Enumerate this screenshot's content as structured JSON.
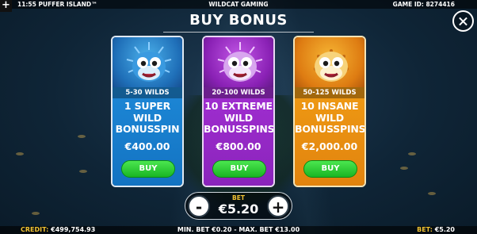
{
  "topbar": {
    "time_game": "11:55 PUFFER ISLAND™",
    "provider": "WILDCAT GAMING",
    "game_id": "GAME ID: 8274416",
    "menu_label": "+"
  },
  "title": "BUY BONUS",
  "close_icon": "close-icon",
  "cards": [
    {
      "wilds": "5-30 WILDS",
      "line1": "1 SUPER",
      "line2": "WILD",
      "line3": "BONUSSPIN",
      "price": "€400.00",
      "buy": "BUY",
      "color": "#1a7fd0"
    },
    {
      "wilds": "20-100 WILDS",
      "line1": "10 EXTREME",
      "line2": "WILD",
      "line3": "BONUSSPINS",
      "price": "€800.00",
      "buy": "BUY",
      "color": "#9a2cc9"
    },
    {
      "wilds": "50-125 WILDS",
      "line1": "10 INSANE",
      "line2": "WILD",
      "line3": "BONUSSPINS",
      "price": "€2,000.00",
      "buy": "BUY",
      "color": "#ea9012"
    }
  ],
  "bet": {
    "label": "BET",
    "value": "€5.20",
    "minus": "-",
    "plus": "+"
  },
  "bottombar": {
    "credit_label": "CREDIT:",
    "credit_value": "€499,754.93",
    "limits": "MIN. BET €0.20 - MAX. BET €13.00",
    "bet_label": "BET:",
    "bet_value": "€5.20"
  }
}
